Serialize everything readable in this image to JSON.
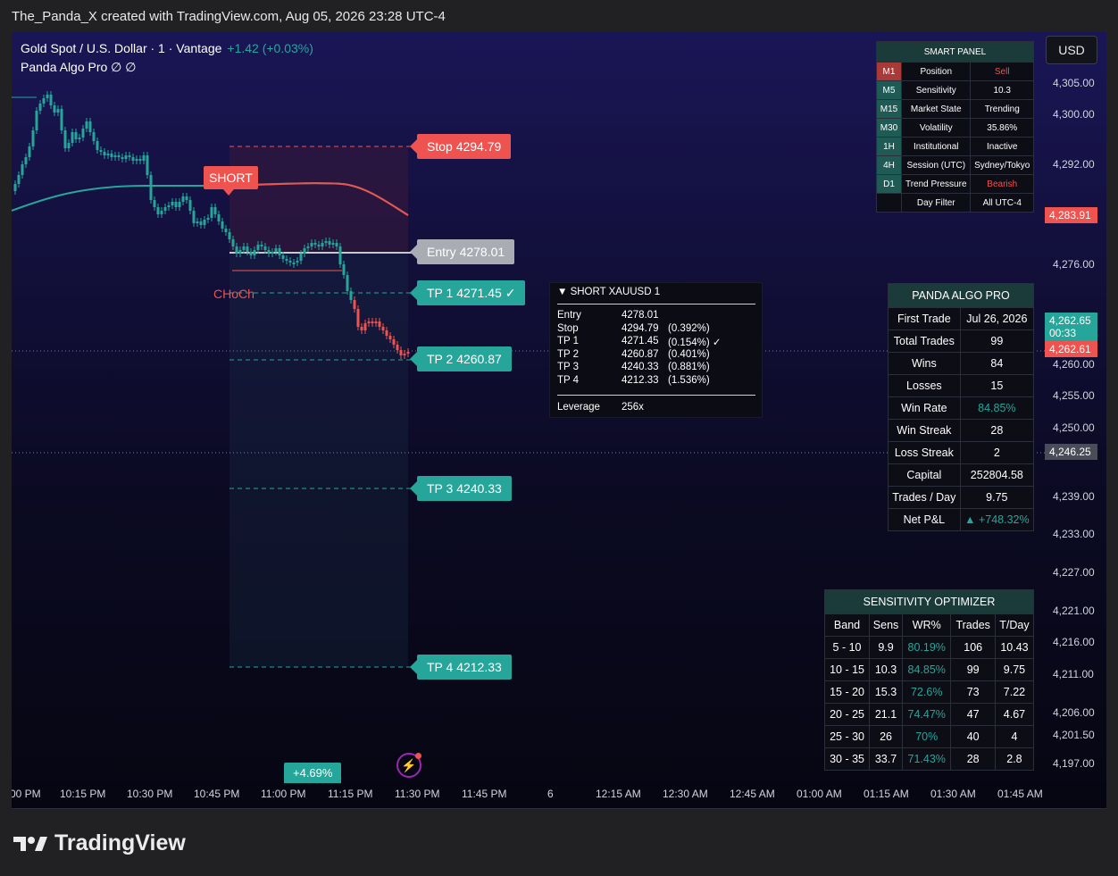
{
  "topbar": {
    "text": "The_Panda_X created with TradingView.com, Aug 05, 2026 23:28 UTC-4"
  },
  "header": {
    "symbol_line": "Gold Spot / U.S. Dollar · 1 · Vantage",
    "change": "+1.42 (+0.03%)",
    "indicator_line": "Panda Algo Pro  ∅  ∅"
  },
  "currency": "USD",
  "tags": {
    "stop": "Stop  4294.79",
    "entry": "Entry  4278.01",
    "tp1": "TP 1  4271.45  ✓",
    "tp2": "TP 2  4260.87",
    "tp3": "TP 3  4240.33",
    "tp4": "TP 4  4212.33"
  },
  "short_label": "SHORT",
  "choch_label": "CHoCh",
  "tooltip": {
    "title": "▼  SHORT     XAUUSD      1",
    "rows": [
      {
        "label": "Entry",
        "value": "4278.01",
        "pct": ""
      },
      {
        "label": "Stop",
        "value": "4294.79",
        "pct": "(0.392%)"
      },
      {
        "label": "TP 1",
        "value": "4271.45",
        "pct": "(0.154%)  ✓"
      },
      {
        "label": "TP 2",
        "value": "4260.87",
        "pct": "(0.401%)"
      },
      {
        "label": "TP 3",
        "value": "4240.33",
        "pct": "(0.881%)"
      },
      {
        "label": "TP 4",
        "value": "4212.33",
        "pct": "(1.536%)"
      }
    ],
    "leverage_label": "Leverage",
    "leverage_value": "256x"
  },
  "smart_panel": {
    "title": "SMART  PANEL",
    "rows": [
      {
        "tf": "M1",
        "label": "Position",
        "value": "Sell"
      },
      {
        "tf": "M5",
        "label": "Sensitivity",
        "value": "10.3"
      },
      {
        "tf": "M15",
        "label": "Market State",
        "value": "Trending"
      },
      {
        "tf": "M30",
        "label": "Volatility",
        "value": "35.86%"
      },
      {
        "tf": "1H",
        "label": "Institutional",
        "value": "Inactive"
      },
      {
        "tf": "4H",
        "label": "Session (UTC)",
        "value": "Sydney/Tokyo"
      },
      {
        "tf": "D1",
        "label": "Trend Pressure",
        "value": "Bearish"
      },
      {
        "tf": "",
        "label": "Day Filter",
        "value": "All  UTC-4"
      }
    ]
  },
  "algo_pro": {
    "title": "PANDA  ALGO  PRO",
    "rows": [
      {
        "label": "First Trade",
        "value": "Jul 26, 2026"
      },
      {
        "label": "Total Trades",
        "value": "99"
      },
      {
        "label": "Wins",
        "value": "84"
      },
      {
        "label": "Losses",
        "value": "15"
      },
      {
        "label": "Win Rate",
        "value": "84.85%"
      },
      {
        "label": "Win Streak",
        "value": "28"
      },
      {
        "label": "Loss Streak",
        "value": "2"
      },
      {
        "label": "Capital",
        "value": "252804.58"
      },
      {
        "label": "Trades / Day",
        "value": "9.75"
      },
      {
        "label": "Net P&L",
        "value": "▲ +748.32%"
      }
    ]
  },
  "optimizer": {
    "title": "SENSITIVITY  OPTIMIZER",
    "headers": [
      "Band",
      "Sens",
      "WR%",
      "Trades",
      "T/Day"
    ],
    "rows": [
      [
        "5 - 10",
        "9.9",
        "80.19%",
        "106",
        "10.43"
      ],
      [
        "10 - 15",
        "10.3",
        "84.85%",
        "99",
        "9.75"
      ],
      [
        "15 - 20",
        "15.3",
        "72.6%",
        "73",
        "7.22"
      ],
      [
        "20 - 25",
        "21.1",
        "74.47%",
        "47",
        "4.67"
      ],
      [
        "25 - 30",
        "26",
        "70%",
        "40",
        "4"
      ],
      [
        "30 - 35",
        "33.7",
        "71.43%",
        "28",
        "2.8"
      ]
    ]
  },
  "price_axis": [
    "4,305.00",
    "4,300.00",
    "4,292.00",
    "4,276.00",
    "4,260.00",
    "4,255.00",
    "4,250.00",
    "4,239.00",
    "4,233.00",
    "4,227.00",
    "4,221.00",
    "4,216.00",
    "4,211.00",
    "4,206.00",
    "4,201.50",
    "4,197.00"
  ],
  "price_tags": {
    "stop_price": "4,283.91",
    "current_price": "4,262.65",
    "countdown": "00:33",
    "bid_price": "4,262.61",
    "crosshair_price": "4,246.25"
  },
  "time_axis": [
    "00 PM",
    "10:15 PM",
    "10:30 PM",
    "10:45 PM",
    "11:00 PM",
    "11:15 PM",
    "11:30 PM",
    "11:45 PM",
    "6",
    "12:15 AM",
    "12:30 AM",
    "12:45 AM",
    "01:00 AM",
    "01:15 AM",
    "01:30 AM",
    "01:45 AM"
  ],
  "gain_badge": "+4.69%",
  "logo": "TradingView",
  "colors": {
    "bull": "#26a69a",
    "bear": "#ef5350",
    "bg_top": "#1a1656",
    "bg_bottom": "#060612"
  }
}
